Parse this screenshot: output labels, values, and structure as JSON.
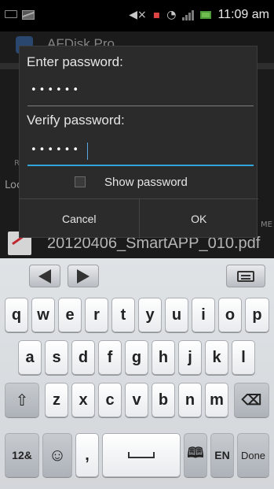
{
  "status_bar": {
    "time": "11:09 am",
    "icons": [
      "usb-icon",
      "gallery-icon",
      "mute-icon",
      "notification-icon",
      "wifi-icon",
      "signal-icon",
      "battery-icon"
    ]
  },
  "background_app": {
    "title": "AFDisk Pro",
    "partial_label_re": "Re",
    "partial_label_loc": "Loc",
    "partial_label_me": "ME",
    "filename": "20120406_SmartAPP_010.pdf"
  },
  "dialog": {
    "enter_label": "Enter password:",
    "enter_value": "••••••",
    "verify_label": "Verify password:",
    "verify_value": "••••••",
    "show_password_label": "Show password",
    "show_password_checked": false,
    "cancel_label": "Cancel",
    "ok_label": "OK"
  },
  "keyboard": {
    "row1": [
      "q",
      "w",
      "e",
      "r",
      "t",
      "y",
      "u",
      "i",
      "o",
      "p"
    ],
    "row2": [
      "a",
      "s",
      "d",
      "f",
      "g",
      "h",
      "j",
      "k",
      "l"
    ],
    "row3": [
      "z",
      "x",
      "c",
      "v",
      "b",
      "n",
      "m"
    ],
    "mode_key": "12&",
    "comma_key": ",",
    "language_key": "EN",
    "done_key": "Done"
  },
  "colors": {
    "focus_accent": "#31a4d8",
    "battery": "#6fbd4f"
  }
}
